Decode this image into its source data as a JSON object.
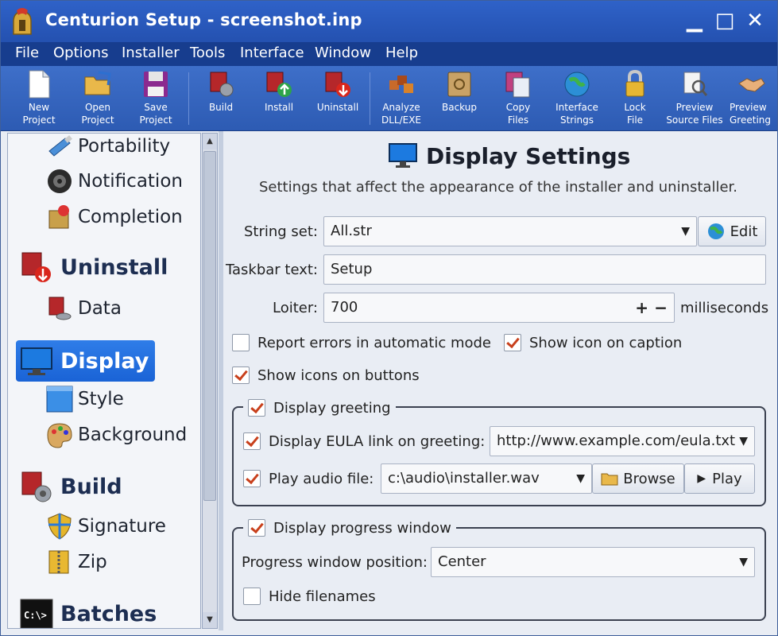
{
  "window": {
    "title": "Centurion Setup - screenshot.inp",
    "minimize": "▁",
    "maximize": "□",
    "close": "✕"
  },
  "menu": [
    "File",
    "Options",
    "Installer",
    "Tools",
    "Interface",
    "Window",
    "Help"
  ],
  "toolbar": {
    "new_project": [
      "New",
      "Project"
    ],
    "open_project": [
      "Open",
      "Project"
    ],
    "save_project": [
      "Save",
      "Project"
    ],
    "build": "Build",
    "install": "Install",
    "uninstall": "Uninstall",
    "analyze": [
      "Analyze",
      "DLL/EXE"
    ],
    "backup": "Backup",
    "copy_files": [
      "Copy",
      "Files"
    ],
    "interface_strings": [
      "Interface",
      "Strings"
    ],
    "lock_file": [
      "Lock",
      "File"
    ],
    "preview_source": [
      "Preview",
      "Source Files"
    ],
    "preview_greeting": [
      "Preview",
      "Greeting"
    ]
  },
  "sidebar": {
    "portability": "Portability",
    "notification": "Notification",
    "completion": "Completion",
    "uninstall": "Uninstall",
    "data": "Data",
    "display": "Display",
    "style": "Style",
    "background": "Background",
    "build": "Build",
    "signature": "Signature",
    "zip": "Zip",
    "batches": "Batches"
  },
  "content": {
    "title": "Display Settings",
    "subtitle": "Settings that affect the appearance of the installer and uninstaller.",
    "string_set_label": "String set:",
    "string_set_value": "All.str",
    "edit_label": "Edit",
    "taskbar_label": "Taskbar text:",
    "taskbar_value": "Setup",
    "loiter_label": "Loiter:",
    "loiter_value": "700",
    "loiter_unit": "milliseconds",
    "report_errors": "Report errors in automatic mode",
    "show_icon_caption": "Show icon on caption",
    "show_icons_buttons": "Show icons on buttons",
    "greeting_group": "Display greeting",
    "eula_label": "Display EULA link on greeting:",
    "eula_value": "http://www.example.com/eula.txt",
    "audio_label": "Play audio file:",
    "audio_value": "c:\\audio\\installer.wav",
    "browse_label": "Browse",
    "play_label": "Play",
    "progress_group": "Display progress window",
    "progress_pos_label": "Progress window position:",
    "progress_pos_value": "Center",
    "hide_filenames": "Hide filenames"
  },
  "colors": {
    "titlebar": "#2f62c8",
    "menubar": "#173d8e",
    "accent": "#1a63d6",
    "check": "#c8401c"
  }
}
